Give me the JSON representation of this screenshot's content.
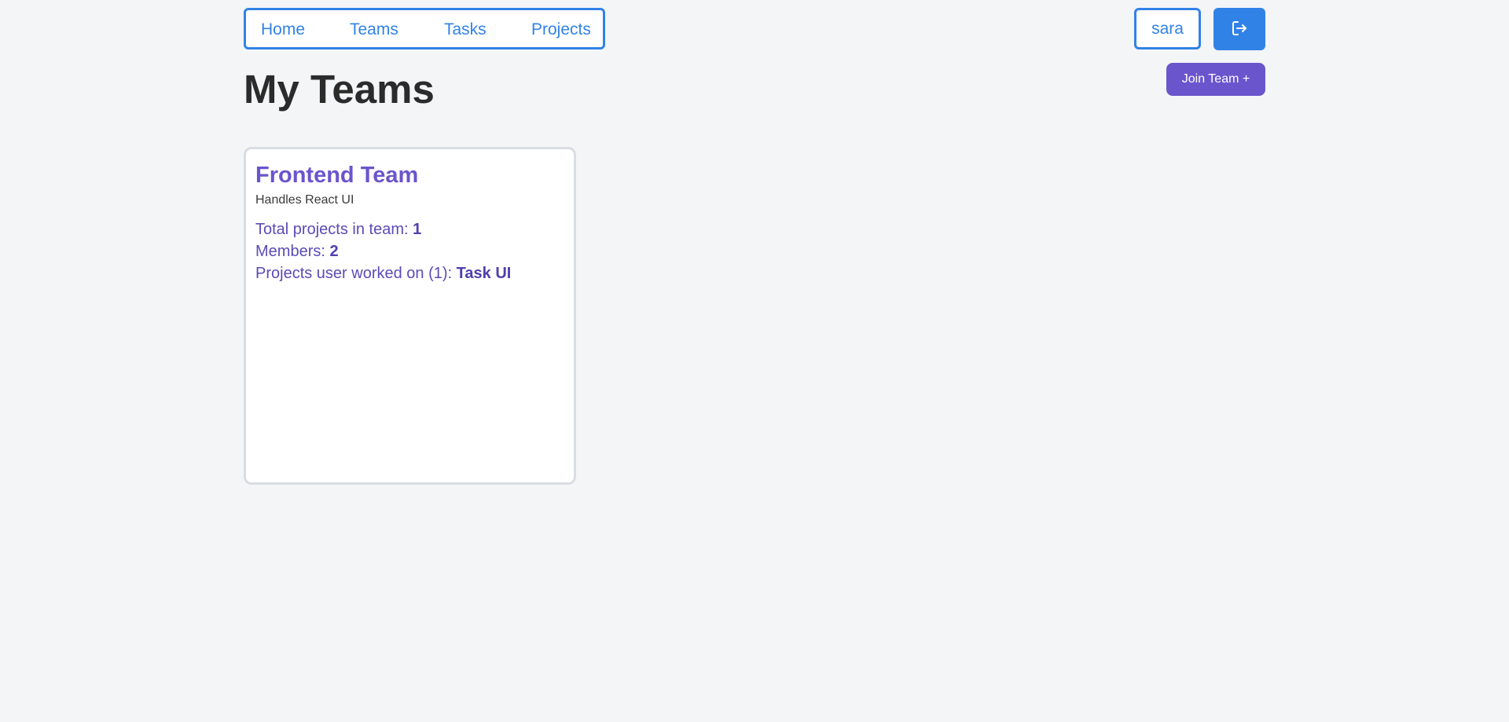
{
  "nav": {
    "items": [
      {
        "label": "Home"
      },
      {
        "label": "Teams"
      },
      {
        "label": "Tasks"
      },
      {
        "label": "Projects"
      }
    ]
  },
  "user": {
    "name": "sara",
    "logout_icon": "logout-icon"
  },
  "header": {
    "title": "My Teams",
    "join_button_label": "Join Team +"
  },
  "teams": [
    {
      "name": "Frontend Team",
      "description": "Handles React UI",
      "total_projects_label": "Total projects in team: ",
      "total_projects": "1",
      "members_label": "Members: ",
      "members": "2",
      "worked_on_label": "Projects user worked on (1): ",
      "worked_on": "Task UI"
    }
  ],
  "colors": {
    "accent_blue": "#3182e6",
    "accent_purple": "#6b55cc",
    "background": "#f3f5f7"
  }
}
